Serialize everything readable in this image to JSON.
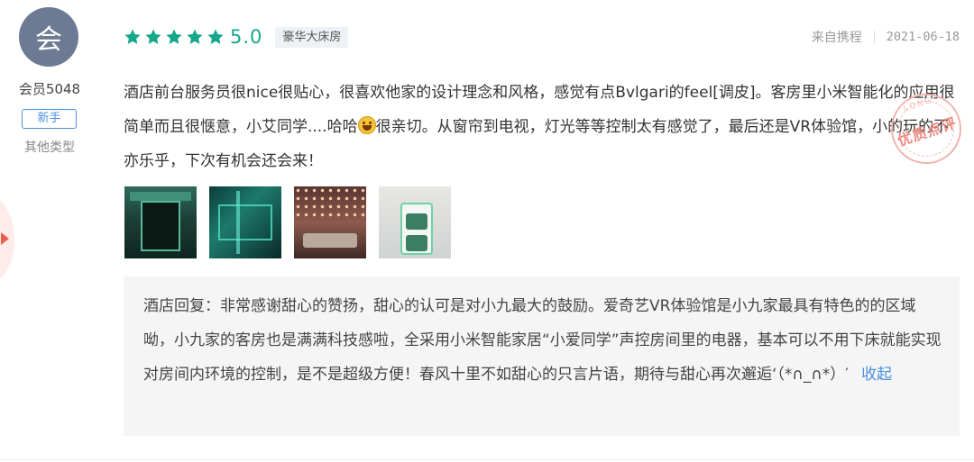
{
  "user": {
    "avatar_char": "会",
    "name": "会员5048",
    "badge": "新手",
    "type": "其他类型"
  },
  "rating": {
    "stars": 5,
    "score": "5.0",
    "room_type": "豪华大床房",
    "star_color": "#17a78a"
  },
  "meta": {
    "source": "来自携程",
    "date": "2021-06-18"
  },
  "review": {
    "part1": "酒店前台服务员很nice很贴心，很喜欢他家的设计理念和风格，感觉有点Bvlgari的feel[调皮]。客房里小米智能化的应用很简单而且很惬意，小艾同学....哈哈",
    "emoji_icon": "grinning-face-emoji",
    "part2": "很亲切。从窗帘到电视，灯光等等控制太有感觉了，最后还是VR体验馆，小的玩的不亦乐乎，下次有机会还会来！"
  },
  "stamp": {
    "top_text": "LONG",
    "main_text": "优质点评"
  },
  "photos": [
    {
      "icon": "review-photo-vr-machine"
    },
    {
      "icon": "review-photo-vr-room"
    },
    {
      "icon": "review-photo-lounge"
    },
    {
      "icon": "review-photo-smart-device"
    }
  ],
  "reply": {
    "text": "酒店回复：非常感谢甜心的赞扬，甜心的认可是对小九最大的鼓励。爱奇艺VR体验馆是小九家最具有特色的的区域呦，小九家的客房也是满满科技感啦，全采用小米智能家居“小爱同学”声控房间里的电器，基本可以不用下床就能实现对房间内环境的控制，是不是超级方便！春风十里不如甜心的只言片语，期待与甜心再次邂逅‘（*∩_∩*）′",
    "collapse_label": "收起"
  },
  "colors": {
    "accent": "#17a78a",
    "link": "#4a90e2",
    "reply_bg": "#f5f5f5"
  }
}
